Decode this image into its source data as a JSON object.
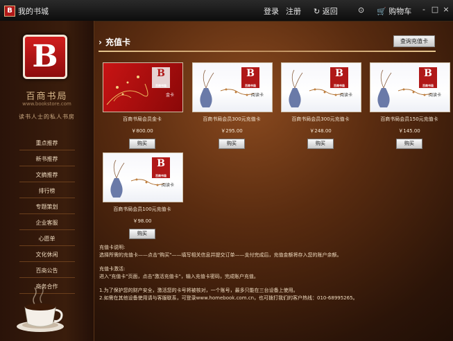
{
  "window": {
    "title": "我的书城",
    "nav": [
      "登录",
      "注册",
      "返回",
      "购物车"
    ],
    "controls": [
      "-",
      "□",
      "×"
    ]
  },
  "sidebar": {
    "logo_letter": "B",
    "brand_name": "百商书局",
    "brand_url": "www.bookstore.com",
    "slogan": "读书人士的私人书房",
    "menu": [
      "重点推荐",
      "新书推荐",
      "文摘推荐",
      "排行榜",
      "专题策划",
      "企业客服",
      "心愿单",
      "文化休闲",
      "百商公告",
      "商务合作"
    ]
  },
  "main": {
    "section_title": "充值卡",
    "query_button": "查询充值卡",
    "cards": [
      {
        "name": "百商书局会员金卡",
        "price": "￥800.00",
        "buy": "购买",
        "style": "red",
        "logo": "B",
        "logo_sub": "百商书局",
        "card_type": "金卡"
      },
      {
        "name": "百商书局会员300元充值卡",
        "price": "￥295.00",
        "buy": "购买",
        "style": "white",
        "logo": "B",
        "logo_sub": "百商书局",
        "card_type": "阅读卡"
      },
      {
        "name": "百商书局会员300元充值卡",
        "price": "￥248.00",
        "buy": "购买",
        "style": "white",
        "logo": "B",
        "logo_sub": "百商书局",
        "card_type": "阅读卡"
      },
      {
        "name": "百商书局会员150元充值卡",
        "price": "￥145.00",
        "buy": "购买",
        "style": "white",
        "logo": "B",
        "logo_sub": "百商书局",
        "card_type": "阅读卡"
      },
      {
        "name": "百商书局会员100元充值卡",
        "price": "￥98.00",
        "buy": "购买",
        "style": "white",
        "logo": "B",
        "logo_sub": "百商书局",
        "card_type": "阅读卡"
      }
    ],
    "notes": {
      "p1_title": "充值卡说明:",
      "p1_text": "选择所需的充值卡——点击\"购买\"——填写相关信息并提交订单——支付完成后，充值金额将存入您的账户余额。",
      "p2_title": "充值卡激活:",
      "p2_text": "进入\"充值卡\"页面，点击\"激活充值卡\"，输入充值卡密码，完成账户充值。",
      "line1": "1.为了保护您的财产安全，激活您的卡号将被核对，一个账号，最多只能在三台设备上使用。",
      "line2": "2.如需在其他设备使用请与客服联系，可登录www.homebook.com.cn，也可拨打我们的客户热线：010-68995265。"
    }
  }
}
